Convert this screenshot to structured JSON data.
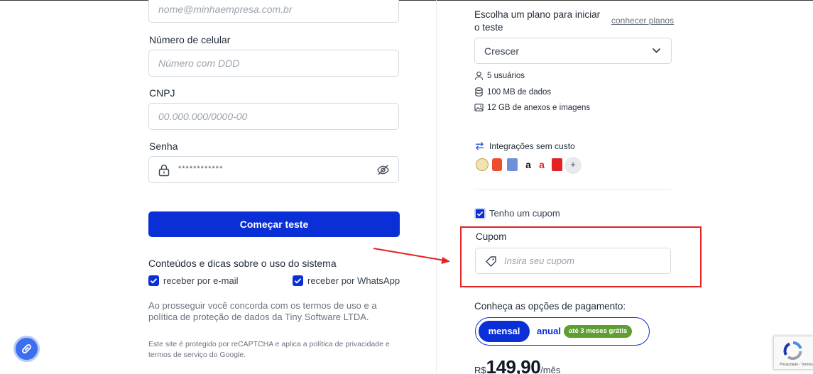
{
  "form": {
    "email_placeholder": "nome@minhaempresa.com.br",
    "phone_label": "Número de celular",
    "phone_placeholder": "Número com DDD",
    "cnpj_label": "CNPJ",
    "cnpj_placeholder": "00.000.000/0000-00",
    "password_label": "Senha",
    "password_masked": "************",
    "submit_label": "Começar teste",
    "content_section_title": "Conteúdos e dicas sobre o uso do sistema",
    "opt_email_label": "receber por e-mail",
    "opt_whatsapp_label": "receber por WhatsApp",
    "terms_text": "Ao prosseguir você concorda com os termos de uso e a política de proteção de dados da Tiny Software LTDA.",
    "recaptcha_text": "Este site é protegido por reCAPTCHA e aplica a política de privacidade e termos de serviço do Google."
  },
  "plan": {
    "title": "Escolha um plano para iniciar o teste",
    "link": "conhecer planos",
    "selected": "Crescer",
    "features": [
      {
        "icon": "user-icon",
        "text": "5 usuários"
      },
      {
        "icon": "database-icon",
        "text": "100 MB de dados"
      },
      {
        "icon": "image-icon",
        "text": "12 GB de anexos e imagens"
      }
    ],
    "integrations_title": "Integrações sem custo",
    "integrations_more": "+"
  },
  "coupon": {
    "checkbox_label": "Tenho um cupom",
    "label": "Cupom",
    "placeholder": "Insira seu cupom"
  },
  "payment": {
    "title": "Conheça as opções de pagamento:",
    "monthly": "mensal",
    "yearly": "anual",
    "yearly_badge": "até 3 meses grátis",
    "currency": "R$",
    "amount": "149,90",
    "period": "/mês"
  },
  "recaptcha_badge": {
    "text": "Privacidade - Termos"
  },
  "colors": {
    "primary": "#0a2fd6",
    "highlight": "#e52222",
    "badge": "#5f9e32"
  }
}
